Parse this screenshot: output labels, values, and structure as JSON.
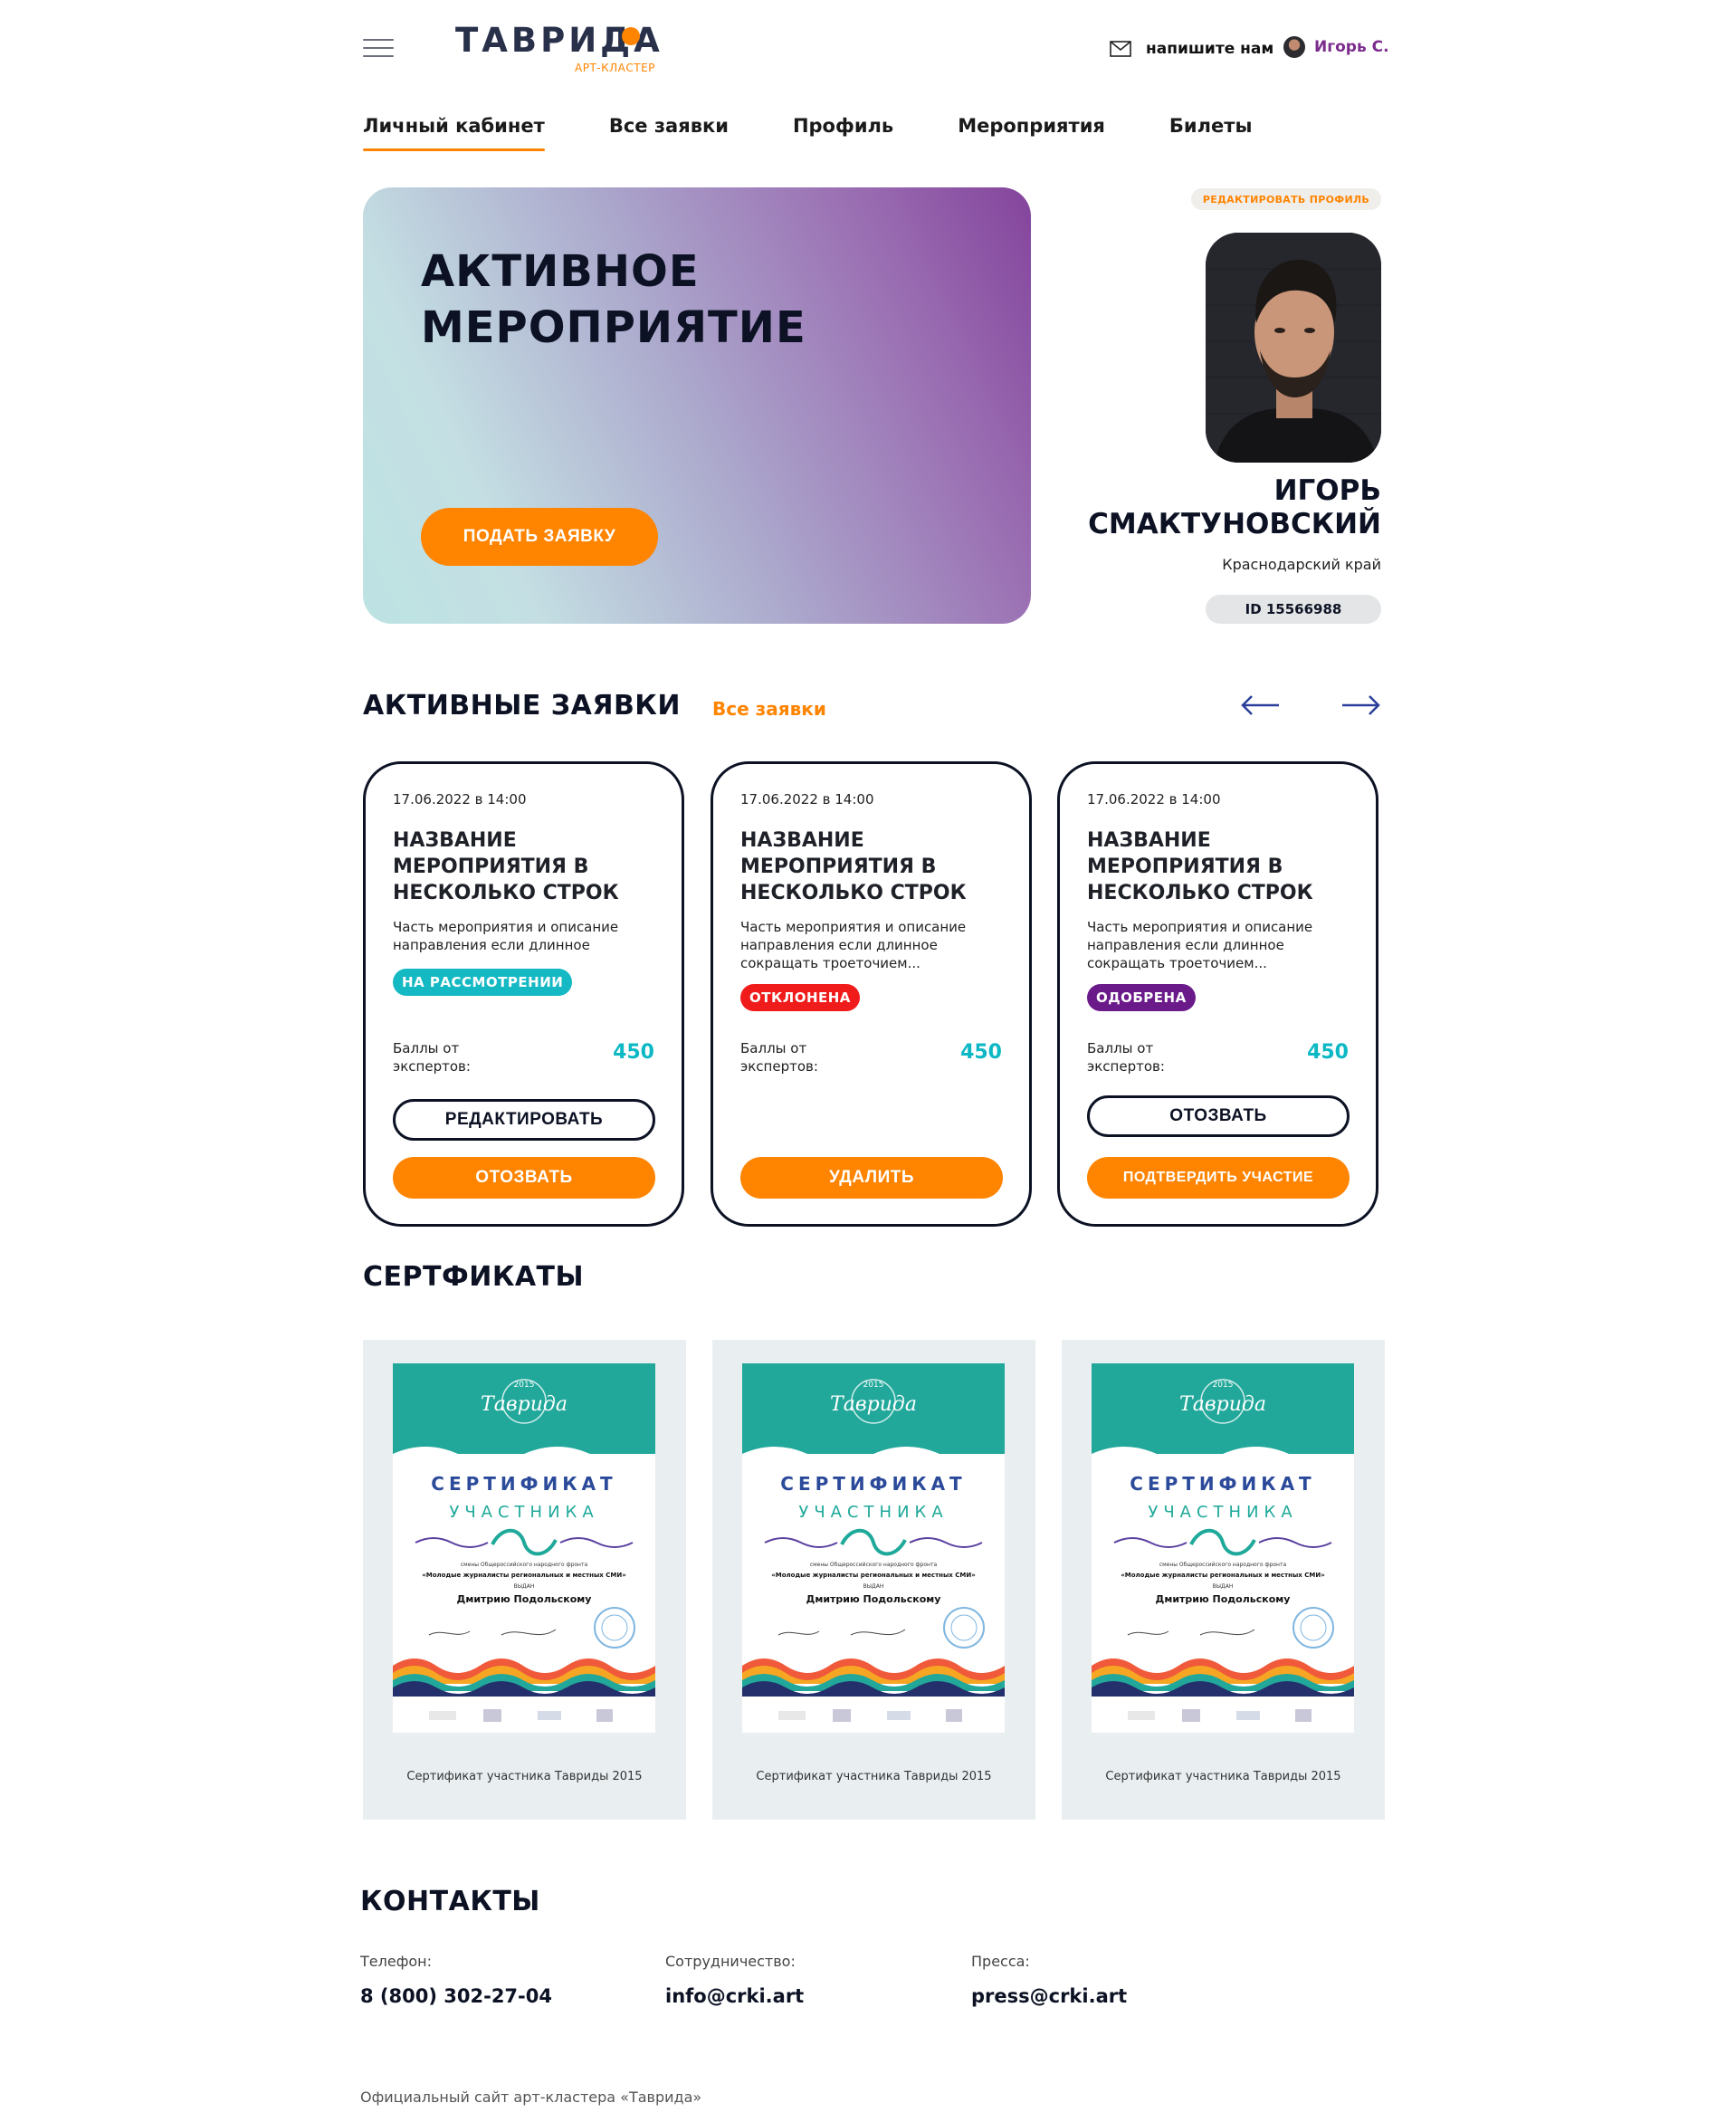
{
  "header": {
    "logo_text": "ТАВРИДА",
    "logo_sub": "АРТ-КЛАСТЕР",
    "write_us": "напишите нам",
    "user_short": "Игорь С."
  },
  "nav": [
    "Личный кабинет",
    "Все заявки",
    "Профиль",
    "Мероприятия",
    "Билеты"
  ],
  "hero": {
    "title": "АКТИВНОЕ МЕРОПРИЯТИЕ",
    "button": "ПОДАТЬ ЗАЯВКУ"
  },
  "profile": {
    "edit_link": "РЕДАКТИРОВАТЬ ПРОФИЛЬ",
    "name": "ИГОРЬ СМАКТУНОВСКИЙ",
    "region": "Краснодарский край",
    "id": "ID 15566988"
  },
  "requests": {
    "title": "АКТИВНЫЕ ЗАЯВКИ",
    "all_link": "Все заявки",
    "cards": [
      {
        "date": "17.06.2022 в 14:00",
        "title": "НАЗВАНИЕ МЕРОПРИЯТИЯ В НЕСКОЛЬКО СТРОК",
        "desc": "Часть мероприятия и описание направления если длинное",
        "status": "НА РАССМОТРЕНИИ",
        "status_color": "#14b9c3",
        "points_label": "Баллы от экспертов:",
        "points": "450",
        "outline_btn": "РЕДАКТИРОВАТЬ",
        "orange_btn": "ОТОЗВАТЬ"
      },
      {
        "date": "17.06.2022 в 14:00",
        "title": "НАЗВАНИЕ МЕРОПРИЯТИЯ В НЕСКОЛЬКО СТРОК",
        "desc": "Часть мероприятия и описание направления если длинное сокращать троеточием...",
        "status": "ОТКЛОНЕНА",
        "status_color": "#f01c1c",
        "points_label": "Баллы от экспертов:",
        "points": "450",
        "orange_btn": "УДАЛИТЬ"
      },
      {
        "date": "17.06.2022 в 14:00",
        "title": "НАЗВАНИЕ МЕРОПРИЯТИЯ В НЕСКОЛЬКО СТРОК",
        "desc": "Часть мероприятия и описание направления если длинное сокращать троеточием...",
        "status": "ОДОБРЕНА",
        "status_color": "#6b1a8a",
        "points_label": "Баллы от экспертов:",
        "points": "450",
        "outline_btn": "ОТОЗВАТЬ",
        "orange_btn": "ПОДТВЕРДИТЬ УЧАСТИЕ"
      }
    ]
  },
  "certificates": {
    "title": "СЕРТФИКАТЫ",
    "items": [
      {
        "caption": "Сертификат участника Тавриды 2015"
      },
      {
        "caption": "Сертификат участника Тавриды 2015"
      },
      {
        "caption": "Сертификат участника Тавриды 2015"
      }
    ],
    "image": {
      "year": "2015",
      "logo": "Таврида",
      "line1": "СЕРТИФИКАТ",
      "line2": "УЧАСТНИКА",
      "text1": "смены Общероссийского народного фронта",
      "text2": "«Молодые журналисты региональных и местных СМИ»",
      "text3": "ВЫДАН",
      "recipient": "Дмитрию Подольскому"
    }
  },
  "contacts": {
    "title": "КОНТАКТЫ",
    "phone_label": "Телефон:",
    "phone": "8 (800) 302-27-04",
    "coop_label": "Сотрудничество:",
    "coop": "info@crki.art",
    "press_label": "Пресса:",
    "press": "press@crki.art"
  },
  "footer": "Официальный сайт арт-кластера «Таврида»",
  "colors": {
    "accent": "#ff8400",
    "dark": "#0c1224",
    "teal": "#0cb8c4",
    "arrow": "#2b3f9a"
  }
}
